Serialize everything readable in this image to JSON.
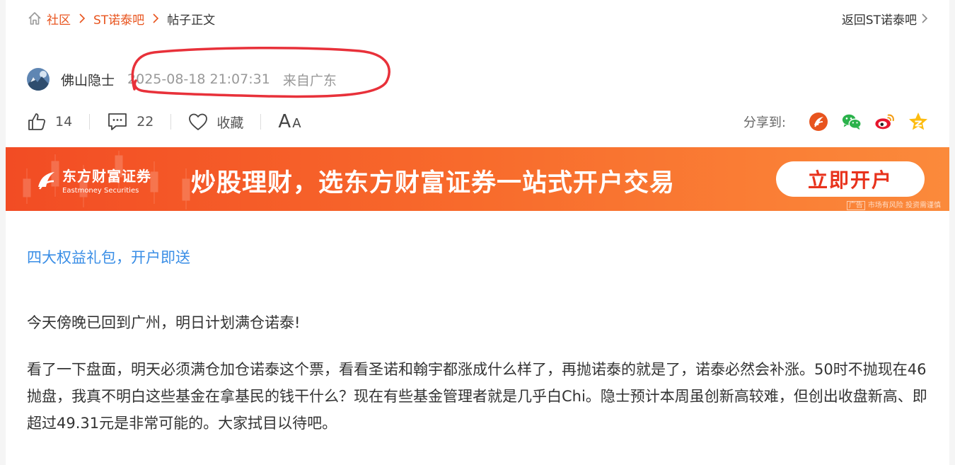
{
  "breadcrumb": {
    "items": [
      "社区",
      "ST诺泰吧"
    ],
    "current": "帖子正文"
  },
  "back_link": "返回ST诺泰吧",
  "post": {
    "author": "佛山隐士",
    "time": "2025-08-18 21:07:31",
    "location": "来自广东"
  },
  "actions": {
    "likes": "14",
    "comments": "22",
    "favorite_label": "收藏",
    "font_big": "A",
    "font_small": "A",
    "share_label": "分享到:"
  },
  "share_icons": [
    "eastmoney-icon",
    "wechat-icon",
    "weibo-icon",
    "qzone-icon"
  ],
  "banner": {
    "logo_cn": "东方财富证券",
    "logo_en": "Eastmoney Securities",
    "slogan": "炒股理财，选东方财富证券一站式开户交易",
    "button": "立即开户",
    "ad_tag": "广告",
    "ad_note": "市场有风险 投资需谨慎"
  },
  "promo_link": "四大权益礼包，开户即送",
  "body": {
    "p1": "今天傍晚已回到广州，明日计划满仓诺泰!",
    "p2": "看了一下盘面，明天必须满仓加仓诺泰这个票，看看圣诺和翰宇都涨成什么样了，再抛诺泰的就是了，诺泰必然会补涨。50时不抛现在46抛盘，我真不明白这些基金在拿基民的钱干什么？现在有些基金管理者就是几乎白Chi。隐士预计本周虽创新高较难，但创出收盘新高、即超过49.31元是非常可能的。大家拭目以待吧。"
  },
  "colors": {
    "accent": "#e8541e",
    "link": "#3a8ee6",
    "banner_start": "#f24c24",
    "banner_end": "#fb8a3b",
    "scribble": "#e8313a"
  }
}
